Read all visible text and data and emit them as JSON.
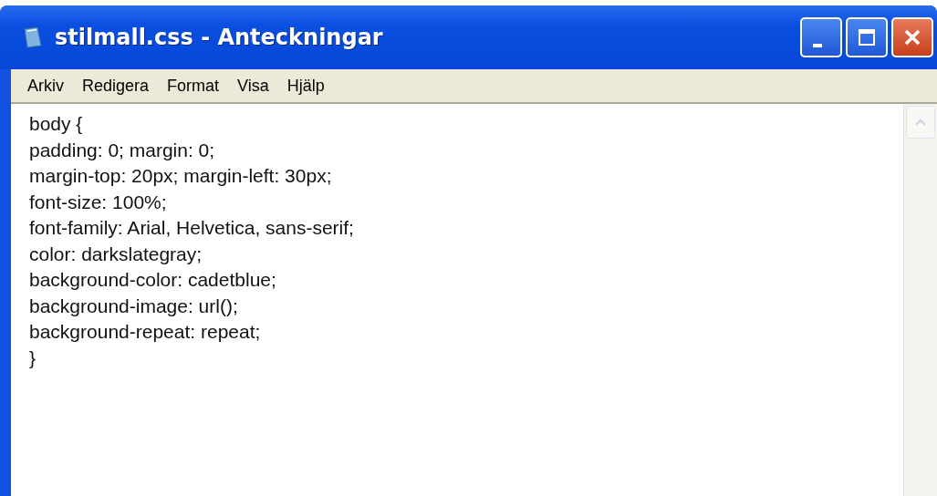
{
  "window": {
    "title": "stilmall.css - Anteckningar"
  },
  "menu": [
    "Arkiv",
    "Redigera",
    "Format",
    "Visa",
    "Hjälp"
  ],
  "editor": {
    "lines": [
      "body {",
      "padding: 0; margin: 0;",
      "margin-top: 20px; margin-left: 30px;",
      "font-size: 100%;",
      "font-family: Arial, Helvetica, sans-serif;",
      "color: darkslategray;",
      "background-color: cadetblue;",
      "background-image: url();",
      "background-repeat: repeat;",
      "}"
    ]
  }
}
